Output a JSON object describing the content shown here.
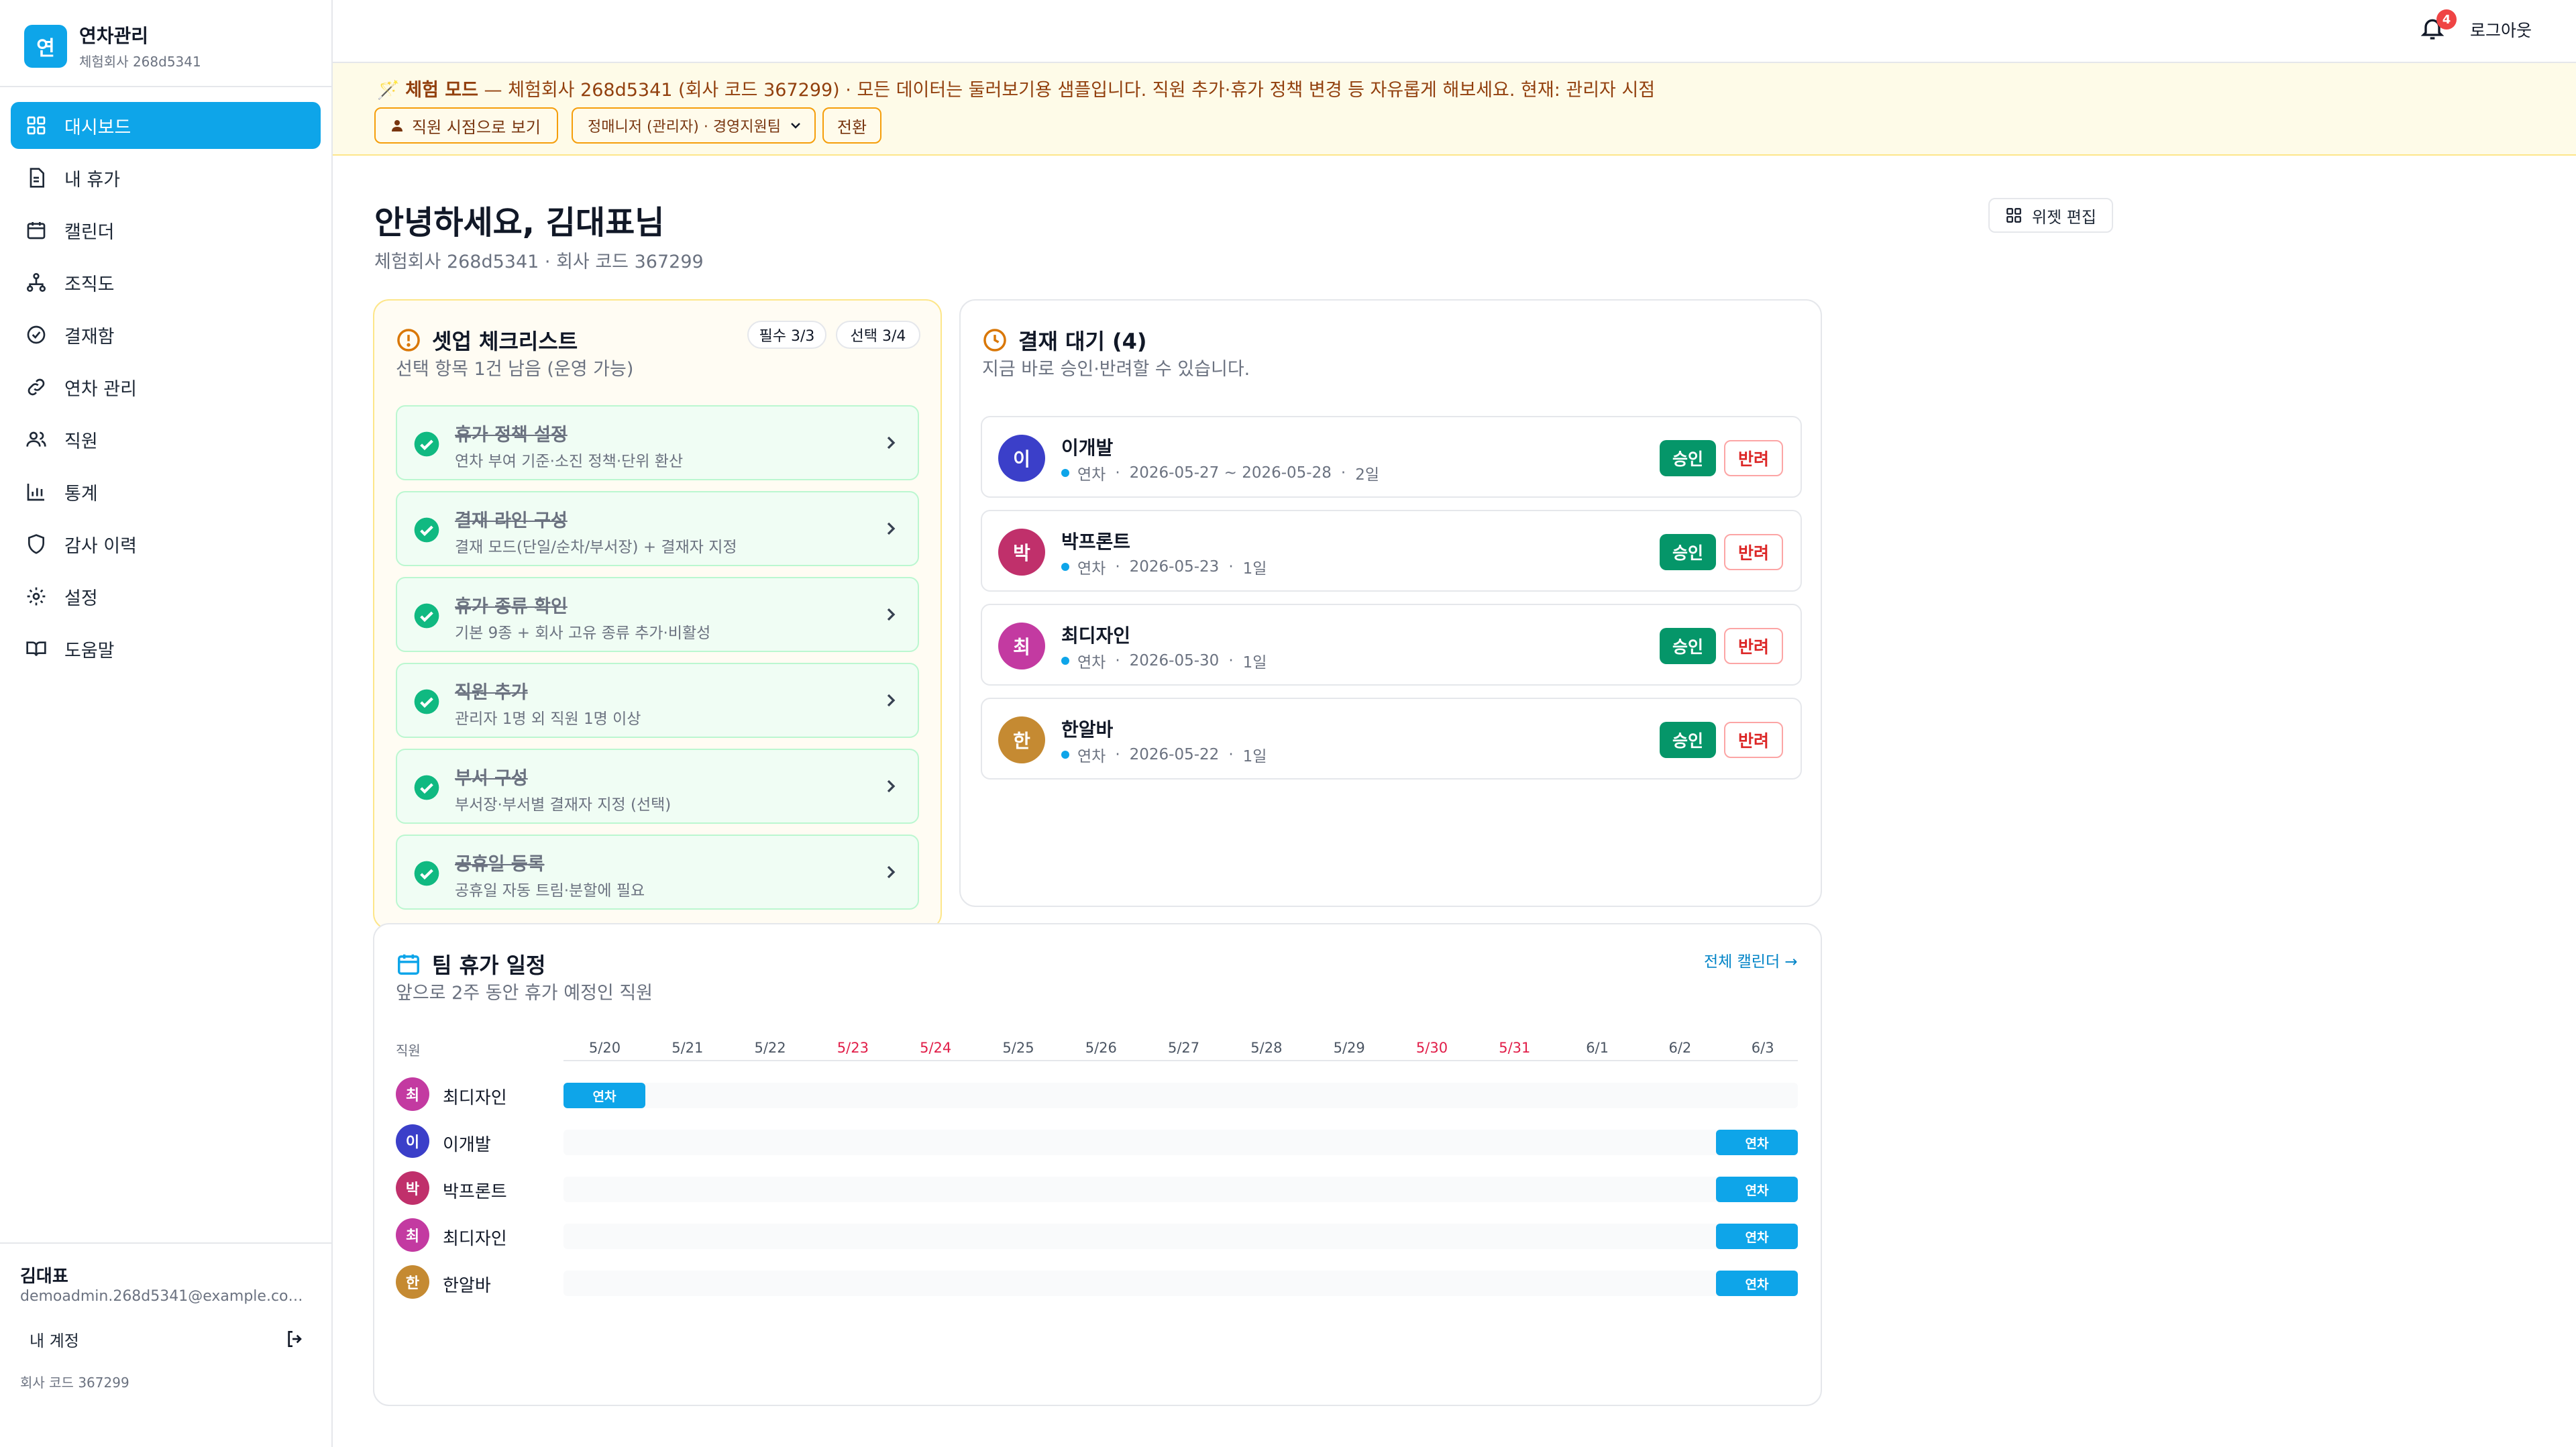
{
  "brand": {
    "logo_char": "연",
    "name": "연차관리",
    "company": "체험회사 268d5341"
  },
  "sidebar": {
    "items": [
      {
        "label": "대시보드",
        "icon": "dashboard-icon",
        "active": true
      },
      {
        "label": "내 휴가",
        "icon": "document-icon"
      },
      {
        "label": "캘린더",
        "icon": "calendar-icon"
      },
      {
        "label": "조직도",
        "icon": "org-chart-icon"
      },
      {
        "label": "결재함",
        "icon": "check-circle-icon"
      },
      {
        "label": "연차 관리",
        "icon": "link-icon"
      },
      {
        "label": "직원",
        "icon": "users-icon"
      },
      {
        "label": "통계",
        "icon": "chart-icon"
      },
      {
        "label": "감사 이력",
        "icon": "shield-icon"
      },
      {
        "label": "설정",
        "icon": "gear-icon"
      },
      {
        "label": "도움말",
        "icon": "book-icon"
      }
    ],
    "user_name": "김대표",
    "user_email": "demoadmin.268d5341@example.com · ...",
    "my_account": "내 계정",
    "company_code": "회사  코드  367299"
  },
  "topbar": {
    "notifications": "4",
    "logout": "로그아웃"
  },
  "banner": {
    "mode_label": "체험 모드",
    "message": " — 체험회사 268d5341 (회사 코드 367299) · 모든 데이터는 둘러보기용 샘플입니다. 직원 추가·휴가 정책 변경 등 자유롭게 해보세요. 현재: 관리자 시점",
    "view_as_employee": "직원 시점으로 보기",
    "select_value": "정매니저 (관리자) · 경영지원팀",
    "switch_label": "전환"
  },
  "main": {
    "greeting": "안녕하세요, 김대표님",
    "sub": "체험회사 268d5341 · 회사 코드 367299",
    "widget_edit": "위젯 편집"
  },
  "setup": {
    "title": "셋업 체크리스트",
    "subtitle": "선택 항목 1건 남음 (운영 가능)",
    "required": "필수 3/3",
    "optional": "선택 3/4",
    "items": [
      {
        "title": "휴가 정책 설정",
        "desc": "연차 부여 기준·소진 정책·단위 환산"
      },
      {
        "title": "결재 라인 구성",
        "desc": "결재 모드(단일/순차/부서장) + 결재자 지정"
      },
      {
        "title": "휴가 종류 확인",
        "desc": "기본 9종 + 회사 고유 종류 추가·비활성"
      },
      {
        "title": "직원 추가",
        "desc": "관리자 1명 외 직원 1명 이상"
      },
      {
        "title": "부서 구성",
        "desc": "부서장·부서별 결재자 지정 (선택)"
      },
      {
        "title": "공휴일 등록",
        "desc": "공휴일 자동 트림·분할에 필요"
      }
    ]
  },
  "approval": {
    "title": "결재 대기 (4)",
    "subtitle": "지금 바로 승인·반려할 수 있습니다.",
    "approve": "승인",
    "reject": "반려",
    "requests": [
      {
        "initial": "이",
        "name": "이개발",
        "type": "연차",
        "period": "2026-05-27 ~ 2026-05-28",
        "days": "2일",
        "color": "#3b3fc9"
      },
      {
        "initial": "박",
        "name": "박프론트",
        "type": "연차",
        "period": "2026-05-23",
        "days": "1일",
        "color": "#c0306b"
      },
      {
        "initial": "최",
        "name": "최디자인",
        "type": "연차",
        "period": "2026-05-30",
        "days": "1일",
        "color": "#c33aa1"
      },
      {
        "initial": "한",
        "name": "한알바",
        "type": "연차",
        "period": "2026-05-22",
        "days": "1일",
        "color": "#c58a32"
      }
    ]
  },
  "team": {
    "title": "팀 휴가 일정",
    "subtitle": "앞으로 2주 동안 휴가 예정인 직원",
    "link": "전체 캘린더 →",
    "column_label": "직원",
    "dates": [
      {
        "label": "5/20",
        "weekend": false
      },
      {
        "label": "5/21",
        "weekend": false
      },
      {
        "label": "5/22",
        "weekend": false
      },
      {
        "label": "5/23",
        "weekend": true
      },
      {
        "label": "5/24",
        "weekend": true
      },
      {
        "label": "5/25",
        "weekend": false
      },
      {
        "label": "5/26",
        "weekend": false
      },
      {
        "label": "5/27",
        "weekend": false
      },
      {
        "label": "5/28",
        "weekend": false
      },
      {
        "label": "5/29",
        "weekend": false
      },
      {
        "label": "5/30",
        "weekend": true
      },
      {
        "label": "5/31",
        "weekend": true
      },
      {
        "label": "6/1",
        "weekend": false
      },
      {
        "label": "6/2",
        "weekend": false
      },
      {
        "label": "6/3",
        "weekend": false
      }
    ],
    "rows": [
      {
        "initial": "최",
        "name": "최디자인",
        "color": "#c33aa1",
        "bar_label": "연차",
        "bar_date": "5/20"
      },
      {
        "initial": "이",
        "name": "이개발",
        "color": "#3b3fc9",
        "bar_label": "연차",
        "bar_date": "6/3"
      },
      {
        "initial": "박",
        "name": "박프론트",
        "color": "#c0306b",
        "bar_label": "연차",
        "bar_date": "6/3"
      },
      {
        "initial": "최",
        "name": "최디자인",
        "color": "#c33aa1",
        "bar_label": "연차",
        "bar_date": "6/3"
      },
      {
        "initial": "한",
        "name": "한알바",
        "color": "#c58a32",
        "bar_label": "연차",
        "bar_date": "6/3"
      }
    ]
  },
  "colors": {
    "accent": "#0ea5e9",
    "approve": "#059669",
    "reject": "#dc2626",
    "banner_bg": "#fefbe8",
    "weekend": "#e11d48"
  }
}
